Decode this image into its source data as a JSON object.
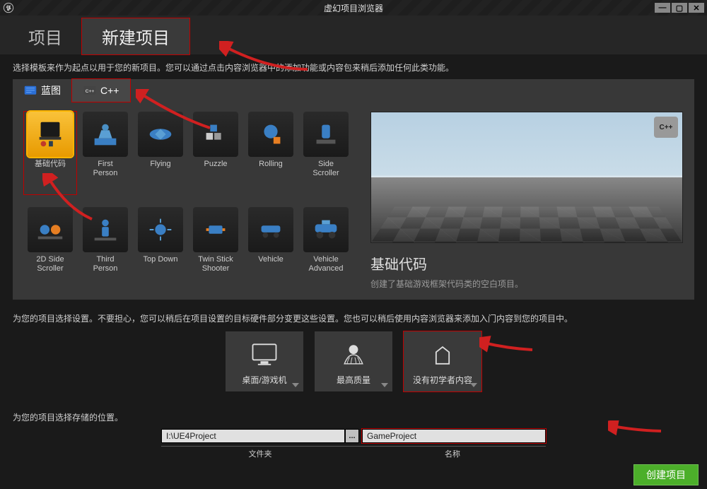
{
  "window": {
    "title": "虚幻项目浏览器"
  },
  "main_tabs": {
    "projects": "项目",
    "new_project": "新建项目"
  },
  "intro_text": "选择模板来作为起点以用于您的新项目。您可以通过点击内容浏览器中的添加功能或内容包来稍后添加任何此类功能。",
  "sub_tabs": {
    "blueprint": "蓝图",
    "cpp": "C++"
  },
  "templates": [
    {
      "id": "basic-code",
      "label": "基础代码",
      "selected": true
    },
    {
      "id": "first-person",
      "label": "First\nPerson"
    },
    {
      "id": "flying",
      "label": "Flying"
    },
    {
      "id": "puzzle",
      "label": "Puzzle"
    },
    {
      "id": "rolling",
      "label": "Rolling"
    },
    {
      "id": "side-scroller",
      "label": "Side\nScroller"
    },
    {
      "id": "2d-side",
      "label": "2D Side\nScroller"
    },
    {
      "id": "third-person",
      "label": "Third\nPerson"
    },
    {
      "id": "top-down",
      "label": "Top Down"
    },
    {
      "id": "twin-stick",
      "label": "Twin Stick\nShooter"
    },
    {
      "id": "vehicle",
      "label": "Vehicle"
    },
    {
      "id": "vehicle-adv",
      "label": "Vehicle\nAdvanced"
    }
  ],
  "preview": {
    "badge": "C++",
    "title": "基础代码",
    "desc": "创建了基础游戏框架代码类的空白项目。"
  },
  "settings_text": "为您的项目选择设置。不要担心，您可以稍后在项目设置的目标硬件部分变更这些设置。您也可以稍后使用内容浏览器来添加入门内容到您的项目中。",
  "settings": {
    "hardware": "桌面/游戏机",
    "quality": "最高质量",
    "starter": "没有初学者内容"
  },
  "location_text": "为您的项目选择存储的位置。",
  "path": {
    "value": "I:\\UE4Project",
    "label": "文件夹",
    "browse": "..."
  },
  "name": {
    "value": "GameProject",
    "label": "名称"
  },
  "create_button": "创建项目"
}
